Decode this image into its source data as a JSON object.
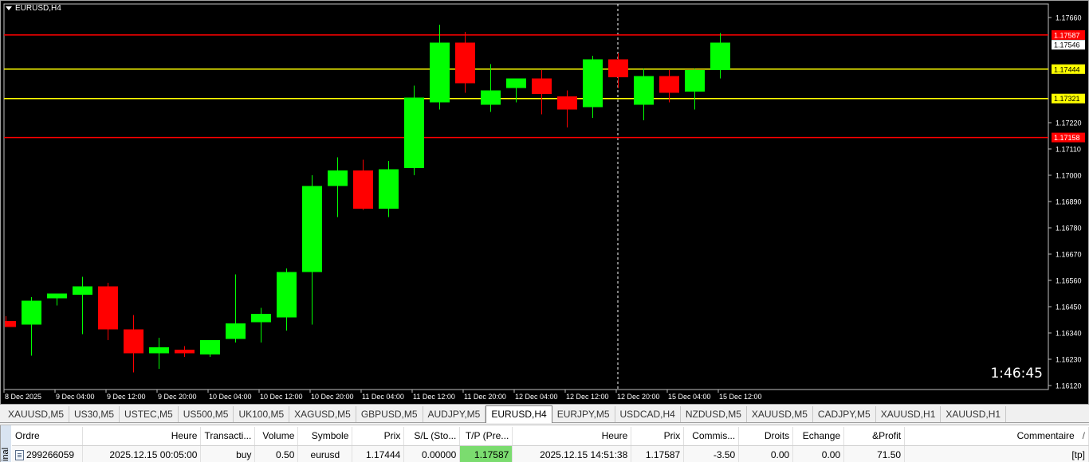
{
  "chart": {
    "title": "EURUSD,H4",
    "countdown": "1:46:45",
    "colors": {
      "bull": "#00ff00",
      "bear": "#ff0000",
      "background": "#000000",
      "red_line": "#ff0000",
      "yellow_line": "#ffff00",
      "axis_text": "#ffffff"
    }
  },
  "chart_data": {
    "type": "candlestick",
    "symbol": "EURUSD",
    "timeframe": "H4",
    "ylim": [
      1.1612,
      1.1769
    ],
    "y_ticks": [
      "1.17660",
      "1.17220",
      "1.17110",
      "1.17000",
      "1.16890",
      "1.16780",
      "1.16670",
      "1.16560",
      "1.16450",
      "1.16340",
      "1.16230",
      "1.16120"
    ],
    "x_ticks": [
      "8 Dec 2025",
      "9 Dec 04:00",
      "9 Dec 12:00",
      "9 Dec 20:00",
      "10 Dec 04:00",
      "10 Dec 12:00",
      "10 Dec 20:00",
      "11 Dec 04:00",
      "11 Dec 12:00",
      "11 Dec 20:00",
      "12 Dec 04:00",
      "12 Dec 12:00",
      "12 Dec 20:00",
      "15 Dec 04:00",
      "15 Dec 12:00"
    ],
    "candles": [
      {
        "o": 1.1639,
        "h": 1.1641,
        "l": 1.1637,
        "c": 1.16365
      },
      {
        "o": 1.16375,
        "h": 1.1649,
        "l": 1.16245,
        "c": 1.16475
      },
      {
        "o": 1.16485,
        "h": 1.16505,
        "l": 1.16455,
        "c": 1.16505
      },
      {
        "o": 1.165,
        "h": 1.16575,
        "l": 1.16335,
        "c": 1.16535
      },
      {
        "o": 1.16535,
        "h": 1.1655,
        "l": 1.1631,
        "c": 1.16355
      },
      {
        "o": 1.16355,
        "h": 1.16415,
        "l": 1.16175,
        "c": 1.16255
      },
      {
        "o": 1.16255,
        "h": 1.1632,
        "l": 1.1619,
        "c": 1.1628
      },
      {
        "o": 1.1627,
        "h": 1.16285,
        "l": 1.1624,
        "c": 1.16255
      },
      {
        "o": 1.1625,
        "h": 1.1631,
        "l": 1.1624,
        "c": 1.1631
      },
      {
        "o": 1.16315,
        "h": 1.16585,
        "l": 1.163,
        "c": 1.1638
      },
      {
        "o": 1.16385,
        "h": 1.16445,
        "l": 1.163,
        "c": 1.1642
      },
      {
        "o": 1.16405,
        "h": 1.1661,
        "l": 1.1635,
        "c": 1.16595
      },
      {
        "o": 1.16595,
        "h": 1.17,
        "l": 1.16375,
        "c": 1.16955
      },
      {
        "o": 1.16955,
        "h": 1.17075,
        "l": 1.16825,
        "c": 1.1702
      },
      {
        "o": 1.1702,
        "h": 1.17065,
        "l": 1.16855,
        "c": 1.1686
      },
      {
        "o": 1.1686,
        "h": 1.1706,
        "l": 1.16825,
        "c": 1.17025
      },
      {
        "o": 1.1703,
        "h": 1.17375,
        "l": 1.17,
        "c": 1.17325
      },
      {
        "o": 1.17305,
        "h": 1.1763,
        "l": 1.17275,
        "c": 1.17555
      },
      {
        "o": 1.17555,
        "h": 1.176,
        "l": 1.17345,
        "c": 1.17385
      },
      {
        "o": 1.17295,
        "h": 1.17465,
        "l": 1.17265,
        "c": 1.17355
      },
      {
        "o": 1.17365,
        "h": 1.1739,
        "l": 1.17305,
        "c": 1.17405
      },
      {
        "o": 1.17405,
        "h": 1.1744,
        "l": 1.17255,
        "c": 1.1734
      },
      {
        "o": 1.1733,
        "h": 1.17355,
        "l": 1.172,
        "c": 1.17275
      },
      {
        "o": 1.17285,
        "h": 1.175,
        "l": 1.1724,
        "c": 1.17485
      },
      {
        "o": 1.17485,
        "h": 1.1751,
        "l": 1.17365,
        "c": 1.1741
      },
      {
        "o": 1.17295,
        "h": 1.17445,
        "l": 1.1723,
        "c": 1.17415
      },
      {
        "o": 1.17415,
        "h": 1.1744,
        "l": 1.17305,
        "c": 1.17345
      },
      {
        "o": 1.1735,
        "h": 1.17445,
        "l": 1.17275,
        "c": 1.1744
      },
      {
        "o": 1.1744,
        "h": 1.17595,
        "l": 1.17405,
        "c": 1.17555
      }
    ],
    "horizontal_lines": [
      {
        "value": 1.17587,
        "label": "1.17587",
        "color": "#ff0000"
      },
      {
        "value": 1.17444,
        "label": "1.17444",
        "color": "#ffff00"
      },
      {
        "value": 1.17321,
        "label": "1.17321",
        "color": "#ffff00"
      },
      {
        "value": 1.17158,
        "label": "1.17158",
        "color": "#ff0000"
      }
    ],
    "current_price": {
      "value": 1.17546,
      "label": "1.17546"
    },
    "crosshair_candle_index": 24
  },
  "symbol_tabs": [
    {
      "label": "XAUUSD,M5",
      "active": false
    },
    {
      "label": "US30,M5",
      "active": false
    },
    {
      "label": "USTEC,M5",
      "active": false
    },
    {
      "label": "US500,M5",
      "active": false
    },
    {
      "label": "UK100,M5",
      "active": false
    },
    {
      "label": "XAGUSD,M5",
      "active": false
    },
    {
      "label": "GBPUSD,M5",
      "active": false
    },
    {
      "label": "AUDJPY,M5",
      "active": false
    },
    {
      "label": "EURUSD,H4",
      "active": true
    },
    {
      "label": "EURJPY,M5",
      "active": false
    },
    {
      "label": "USDCAD,H4",
      "active": false
    },
    {
      "label": "NZDUSD,M5",
      "active": false
    },
    {
      "label": "XAUUSD,M5",
      "active": false
    },
    {
      "label": "CADJPY,M5",
      "active": false
    },
    {
      "label": "XAUUSD,H1",
      "active": false
    },
    {
      "label": "XAUUSD,H1",
      "active": false
    }
  ],
  "terminal": {
    "side_label": "inal",
    "columns": [
      "Ordre",
      "Heure",
      "Transacti...",
      "Volume",
      "Symbole",
      "Prix",
      "S/L (Sto...",
      "T/P (Pre...",
      "Heure",
      "Prix",
      "Commis...",
      "Droits",
      "Echange",
      "&Profit",
      "Commentaire"
    ],
    "sort_arrow": "/",
    "row": [
      "299266059",
      "2025.12.15 00:05:00",
      "buy",
      "0.50",
      "eurusd",
      "1.17444",
      "0.00000",
      "1.17587",
      "2025.12.15 14:51:38",
      "1.17587",
      "-3.50",
      "0.00",
      "0.00",
      "71.50",
      "[tp]"
    ]
  }
}
